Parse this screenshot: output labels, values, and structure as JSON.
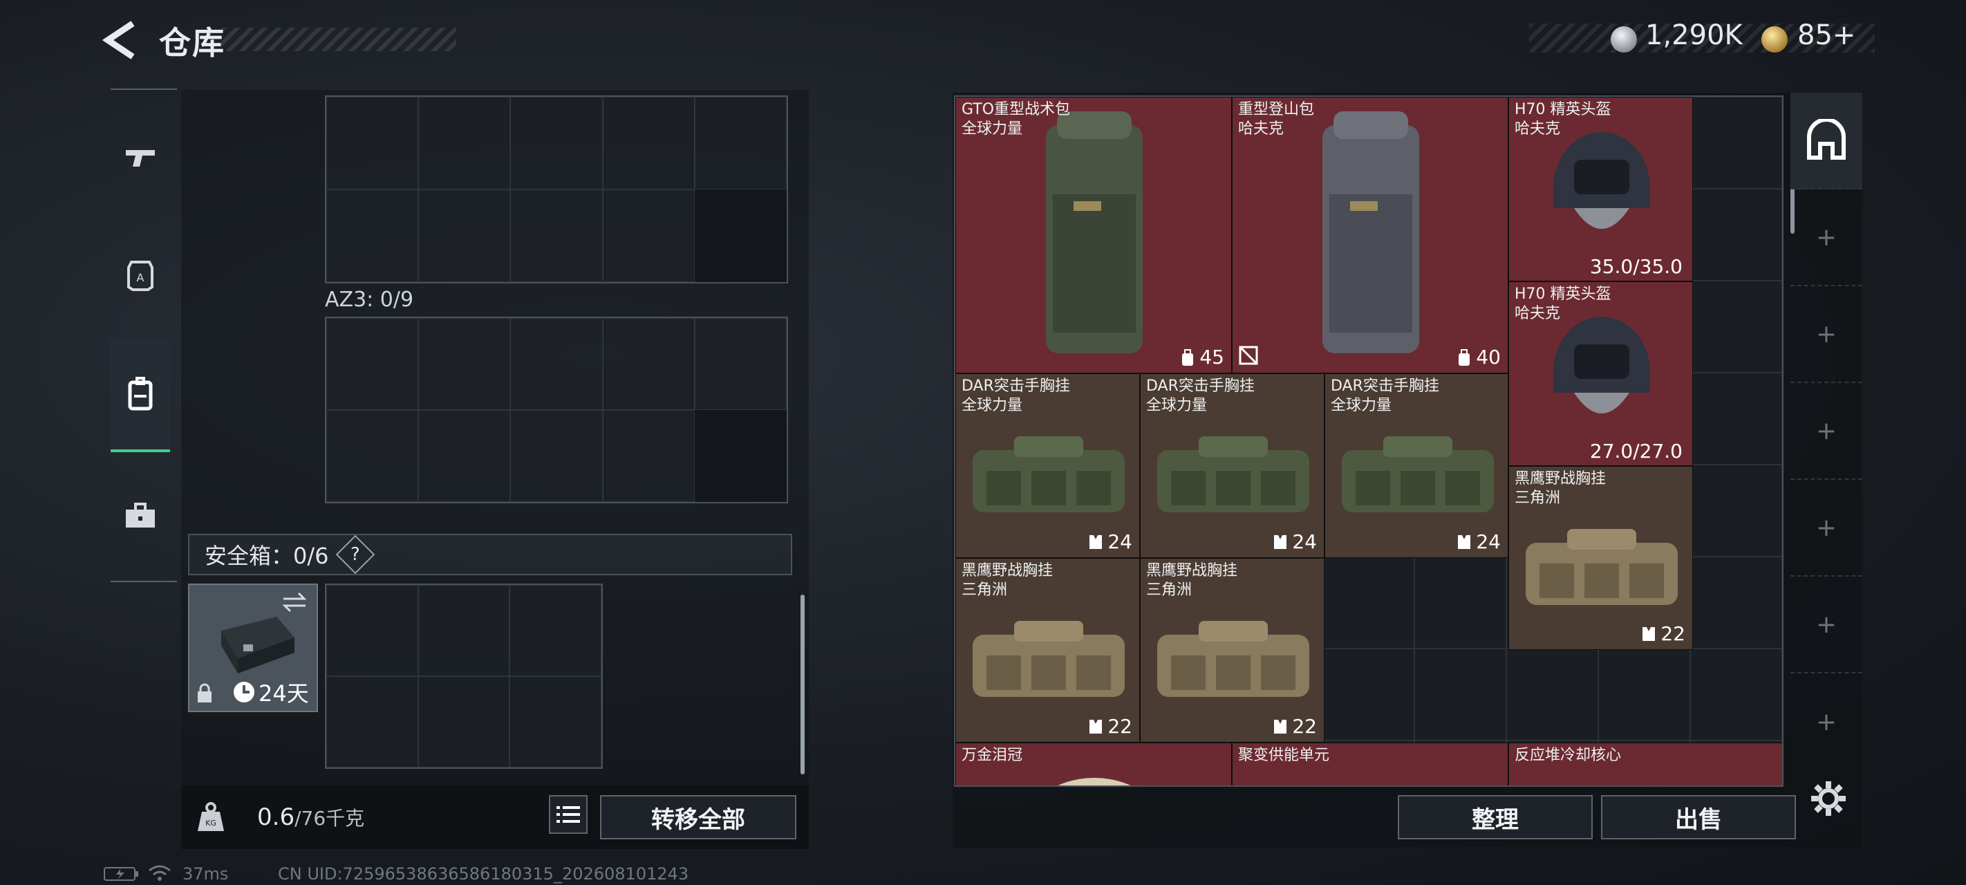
{
  "header": {
    "title": "仓库"
  },
  "currency": {
    "silver": "1,290K",
    "gold": "85+"
  },
  "nav": {
    "items": [
      {
        "icon": "pistol-icon",
        "active": false
      },
      {
        "icon": "armor-icon",
        "active": false
      },
      {
        "icon": "backpack-icon",
        "active": true
      },
      {
        "icon": "toolbox-icon",
        "active": false
      }
    ]
  },
  "left": {
    "az3_label": "AZ3: 0/9",
    "safe_label": "安全箱：0/6",
    "help": "?",
    "safe_time": "24天",
    "weight_value": "0.6",
    "weight_max": "/76千克",
    "transfer_all": "转移全部"
  },
  "stash": {
    "items": [
      {
        "name": "GTO重型战术包",
        "sub": "全球力量",
        "stat": "45",
        "color": "red"
      },
      {
        "name": "重型登山包",
        "sub": "哈夫克",
        "stat": "40",
        "color": "red"
      },
      {
        "name": "H70 精英头盔",
        "sub": "哈夫克",
        "dur": "35.0/35.0",
        "color": "red"
      },
      {
        "name": "H70 精英头盔",
        "sub": "哈夫克",
        "dur": "27.0/27.0",
        "color": "red"
      },
      {
        "name": "DAR突击手胸挂",
        "sub": "全球力量",
        "stat": "24",
        "color": "brown"
      },
      {
        "name": "DAR突击手胸挂",
        "sub": "全球力量",
        "stat": "24",
        "color": "brown"
      },
      {
        "name": "DAR突击手胸挂",
        "sub": "全球力量",
        "stat": "24",
        "color": "brown"
      },
      {
        "name": "黑鹰野战胸挂",
        "sub": "三角洲",
        "stat": "22",
        "color": "brown"
      },
      {
        "name": "黑鹰野战胸挂",
        "sub": "三角洲",
        "stat": "22",
        "color": "brown"
      },
      {
        "name": "黑鹰野战胸挂",
        "sub": "三角洲",
        "stat": "22",
        "color": "brown"
      },
      {
        "name": "万金泪冠",
        "sub": "",
        "color": "red"
      },
      {
        "name": "聚变供能单元",
        "sub": "",
        "color": "red"
      },
      {
        "name": "反应堆冷却核心",
        "sub": "",
        "color": "red"
      }
    ],
    "sort_button": "整理",
    "sell_button": "出售"
  },
  "status": {
    "ping": "37ms",
    "uid": "CN UID:7259653863658618031​5_202608101243"
  },
  "colors": {
    "accent": "#3fcf8e",
    "item_red": "#6b2a31",
    "item_brown": "#4b3c33"
  }
}
